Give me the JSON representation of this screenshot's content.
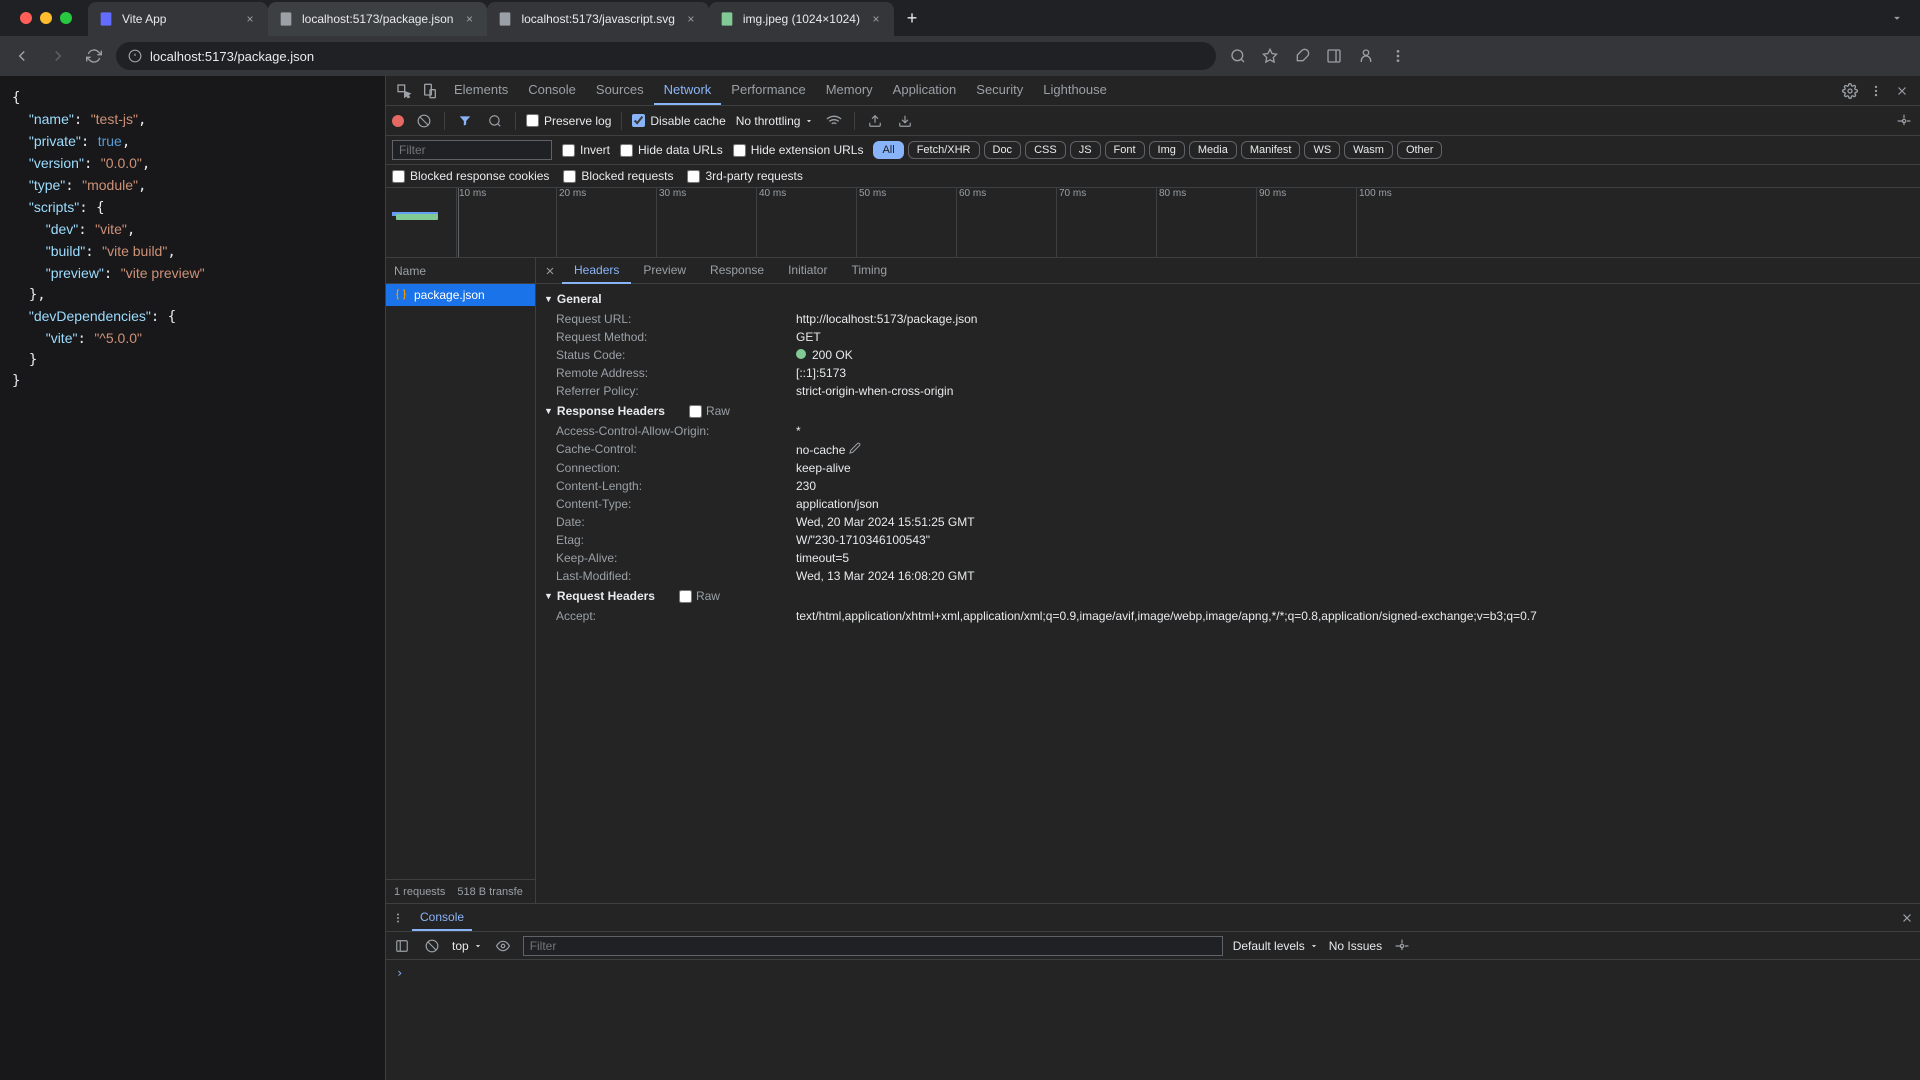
{
  "tabs": [
    {
      "title": "Vite App",
      "icon": "vite"
    },
    {
      "title": "localhost:5173/package.json",
      "icon": "file",
      "active": true
    },
    {
      "title": "localhost:5173/javascript.svg",
      "icon": "file"
    },
    {
      "title": "img.jpeg (1024×1024)",
      "icon": "img"
    }
  ],
  "url": "localhost:5173/package.json",
  "page_json": {
    "name": "test-js",
    "private": true,
    "version": "0.0.0",
    "type": "module",
    "scripts": {
      "dev": "vite",
      "build": "vite build",
      "preview": "vite preview"
    },
    "devDependencies": {
      "vite": "^5.0.0"
    }
  },
  "devtools_tabs": [
    "Elements",
    "Console",
    "Sources",
    "Network",
    "Performance",
    "Memory",
    "Application",
    "Security",
    "Lighthouse"
  ],
  "devtools_active": "Network",
  "net_toolbar": {
    "preserve_log": "Preserve log",
    "disable_cache": "Disable cache",
    "throttling": "No throttling"
  },
  "filter": {
    "placeholder": "Filter",
    "invert": "Invert",
    "hide_data": "Hide data URLs",
    "hide_ext": "Hide extension URLs",
    "types": [
      "All",
      "Fetch/XHR",
      "Doc",
      "CSS",
      "JS",
      "Font",
      "Img",
      "Media",
      "Manifest",
      "WS",
      "Wasm",
      "Other"
    ],
    "type_active": "All",
    "blocked_cookies": "Blocked response cookies",
    "blocked_requests": "Blocked requests",
    "third_party": "3rd-party requests"
  },
  "timeline_ticks": [
    "10 ms",
    "20 ms",
    "30 ms",
    "40 ms",
    "50 ms",
    "60 ms",
    "70 ms",
    "80 ms",
    "90 ms",
    "100 ms"
  ],
  "req_list": {
    "header": "Name",
    "items": [
      {
        "name": "package.json"
      }
    ],
    "status": {
      "count": "1 requests",
      "size": "518 B transfe"
    }
  },
  "detail_tabs": [
    "Headers",
    "Preview",
    "Response",
    "Initiator",
    "Timing"
  ],
  "detail_active": "Headers",
  "headers": {
    "general_title": "General",
    "general": [
      {
        "k": "Request URL:",
        "v": "http://localhost:5173/package.json"
      },
      {
        "k": "Request Method:",
        "v": "GET"
      },
      {
        "k": "Status Code:",
        "v": "200 OK",
        "status": true
      },
      {
        "k": "Remote Address:",
        "v": "[::1]:5173"
      },
      {
        "k": "Referrer Policy:",
        "v": "strict-origin-when-cross-origin"
      }
    ],
    "response_title": "Response Headers",
    "raw": "Raw",
    "response": [
      {
        "k": "Access-Control-Allow-Origin:",
        "v": "*"
      },
      {
        "k": "Cache-Control:",
        "v": "no-cache",
        "edit": true
      },
      {
        "k": "Connection:",
        "v": "keep-alive"
      },
      {
        "k": "Content-Length:",
        "v": "230"
      },
      {
        "k": "Content-Type:",
        "v": "application/json"
      },
      {
        "k": "Date:",
        "v": "Wed, 20 Mar 2024 15:51:25 GMT"
      },
      {
        "k": "Etag:",
        "v": "W/\"230-1710346100543\""
      },
      {
        "k": "Keep-Alive:",
        "v": "timeout=5"
      },
      {
        "k": "Last-Modified:",
        "v": "Wed, 13 Mar 2024 16:08:20 GMT"
      }
    ],
    "request_title": "Request Headers",
    "request": [
      {
        "k": "Accept:",
        "v": "text/html,application/xhtml+xml,application/xml;q=0.9,image/avif,image/webp,image/apng,*/*;q=0.8,application/signed-exchange;v=b3;q=0.7"
      }
    ]
  },
  "console": {
    "tab": "Console",
    "context": "top",
    "filter_placeholder": "Filter",
    "levels": "Default levels",
    "issues": "No Issues"
  }
}
